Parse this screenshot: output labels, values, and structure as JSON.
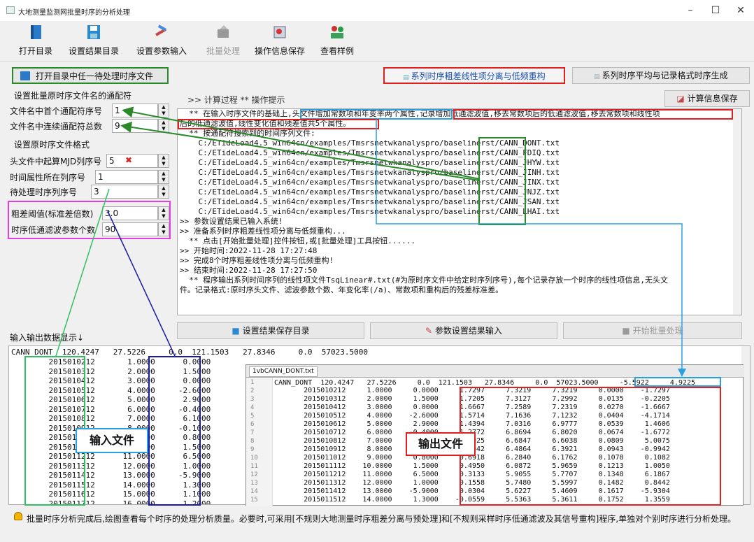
{
  "window": {
    "title": "大地测量监测网批量时序的分析处理",
    "controls": [
      "–",
      "☐",
      "✕"
    ]
  },
  "toolbar": [
    {
      "label": "打开目录",
      "icon": "book-icon",
      "enabled": true
    },
    {
      "label": "设置结果目录",
      "icon": "save-disk-icon",
      "enabled": true
    },
    {
      "label": "设置参数输入",
      "icon": "tools-icon",
      "enabled": true
    },
    {
      "label": "批量处理",
      "icon": "batch-icon",
      "enabled": false
    },
    {
      "label": "操作信息保存",
      "icon": "info-save-icon",
      "enabled": true
    },
    {
      "label": "查看样例",
      "icon": "people-icon",
      "enabled": true
    }
  ],
  "left": {
    "open_button": "打开目录中任一待处理时序文件",
    "group1": "设置批量原时序文件名的通配符",
    "field1_label": "文件名中首个通配符序号",
    "field1_value": "1",
    "field2_label": "文件名中连续通配符总数",
    "field2_value": "9",
    "group2": "设置原时序文件格式",
    "field3_label": "头文件中起算MJD列序号",
    "field3_value": "5",
    "field4_label": "时间属性所在列序号",
    "field4_value": "1",
    "field5_label": "待处理时序列序号",
    "field5_value": "3",
    "field6_label": "粗差阈值(标准差倍数)",
    "field6_value": "3.0",
    "field7_label": "时序低通滤波参数个数",
    "field7_value": "90"
  },
  "tabs": {
    "tab1": "系列时序粗差线性项分离与低频重构",
    "tab2": "系列时序平均与记录格式时序生成"
  },
  "log_header": {
    "prompt": ">> 计算过程  ** 操作提示",
    "save": "计算信息保存"
  },
  "log_lines": [
    "  ** 在输入时序文件的基础上,头文件增加常数项和年变率两个属性,记录增加低通滤波值,移去常数项后的低通滤波值,移去常数项和线性项",
    "后的低通滤波值,线性变化值和残差值共5个属性。",
    "  ** 按通配符搜索到的时间序列文件:",
    "    C:/ETideLoad4.5_win64cn/examples/Tmsrsnetwkanalyspro/baselinerst/CANN_DONT.txt",
    "    C:/ETideLoad4.5_win64cn/examples/Tmsrsnetwkanalyspro/baselinerst/CANN_FDIQ.txt",
    "    C:/ETideLoad4.5_win64cn/examples/Tmsrsnetwkanalyspro/baselinerst/CANN_JHYW.txt",
    "    C:/ETideLoad4.5_win64cn/examples/Tmsrsnetwkanalyspro/baselinerst/CANN_JINH.txt",
    "    C:/ETideLoad4.5_win64cn/examples/Tmsrsnetwkanalyspro/baselinerst/CANN_JINX.txt",
    "    C:/ETideLoad4.5_win64cn/examples/Tmsrsnetwkanalyspro/baselinerst/CANN_JNJZ.txt",
    "    C:/ETideLoad4.5_win64cn/examples/Tmsrsnetwkanalyspro/baselinerst/CANN_JSAN.txt",
    "    C:/ETideLoad4.5_win64cn/examples/Tmsrsnetwkanalyspro/baselinerst/CANN_LHAI.txt",
    ">> 参数设置结果已输入系统!",
    ">> 准备系列时序粗差线性项分离与低频重构...",
    "  ** 点击[开始批量处理]控件按钮,或[批量处理]工具按钮......",
    ">> 开始时间:2022-11-28 17:27:48",
    ">> 完成8个时序粗差线性项分离与低频重构!",
    ">> 结束时间:2022-11-28 17:27:50",
    "  ** 程序输出系列时间序列的线性项文件TsqLinear#.txt(#为原时序文件中给定时序列序号),每个记录存放一个时序的线性项信息,无头文",
    "件。记录格式:原时序头文件、滤波参数个数、年变化率(/a)、常数项和重构后的残差标准差。"
  ],
  "actions": {
    "set_dir": "设置结果保存目录",
    "param_input": "参数设置结果输入",
    "start": "开始批量处理"
  },
  "io_label": "输入输出数据显示↓",
  "input_header": "CANN_DONT  120.4247   27.5226     0.0  121.1503   27.8346     0.0  57023.5000",
  "input_rows": [
    [
      "2015010212",
      "1.0000",
      "0.0000"
    ],
    [
      "2015010312",
      "2.0000",
      "1.5000"
    ],
    [
      "2015010412",
      "3.0000",
      "0.0000"
    ],
    [
      "2015010512",
      "4.0000",
      "-2.6000"
    ],
    [
      "2015010612",
      "5.0000",
      "2.9000"
    ],
    [
      "2015010712",
      "6.0000",
      "-0.4000"
    ],
    [
      "2015010812",
      "7.0000",
      "6.1000"
    ],
    [
      "2015010912",
      "8.0000",
      "-0.1000"
    ],
    [
      "2015011012",
      "9.0000",
      "0.8000"
    ],
    [
      "2015011112",
      "10.0000",
      "1.5000"
    ],
    [
      "2015011212",
      "11.0000",
      "6.5000"
    ],
    [
      "2015011312",
      "12.0000",
      "1.0000"
    ],
    [
      "2015011412",
      "13.0000",
      "-5.9000"
    ],
    [
      "2015011512",
      "14.0000",
      "1.3000"
    ],
    [
      "2015011612",
      "15.0000",
      "1.1000"
    ],
    [
      "2015011712",
      "16.0000",
      "1.2000"
    ]
  ],
  "editor": {
    "tab": "1vbCANN_DONT.txt",
    "header": "CANN_DONT  120.4247   27.5226     0.0  121.1503   27.8346     0.0  57023.5000     -5.5922     4.9225",
    "rows": [
      [
        "2015010212",
        "1.0000",
        "0.0000",
        "1.7297",
        "7.3219",
        "7.3219",
        "0.0000",
        "-1.7297"
      ],
      [
        "2015010312",
        "2.0000",
        "1.5000",
        "1.7205",
        "7.3127",
        "7.2992",
        "0.0135",
        "-0.2205"
      ],
      [
        "2015010412",
        "3.0000",
        "0.0000",
        "1.6667",
        "7.2589",
        "7.2319",
        "0.0270",
        "-1.6667"
      ],
      [
        "2015010512",
        "4.0000",
        "-2.6000",
        "1.5714",
        "7.1636",
        "7.1232",
        "0.0404",
        "-4.1714"
      ],
      [
        "2015010612",
        "5.0000",
        "2.9000",
        "1.4394",
        "7.0316",
        "6.9777",
        "0.0539",
        "1.4606"
      ],
      [
        "2015010712",
        "6.0000",
        "-0.4000",
        "1.2772",
        "6.8694",
        "6.8020",
        "0.0674",
        "-1.6772"
      ],
      [
        "2015010812",
        "7.0000",
        "6.1000",
        "1.0925",
        "6.6847",
        "6.6038",
        "0.0809",
        "5.0075"
      ],
      [
        "2015010912",
        "8.0000",
        "-0.1000",
        "0.8942",
        "6.4864",
        "6.3921",
        "0.0943",
        "-0.9942"
      ],
      [
        "2015011012",
        "9.0000",
        "0.8000",
        "0.6918",
        "6.2840",
        "6.1762",
        "0.1078",
        "0.1082"
      ],
      [
        "2015011112",
        "10.0000",
        "1.5000",
        "0.4950",
        "6.0872",
        "5.9659",
        "0.1213",
        "1.0050"
      ],
      [
        "2015011212",
        "11.0000",
        "6.5000",
        "0.3133",
        "5.9055",
        "5.7707",
        "0.1348",
        "6.1867"
      ],
      [
        "2015011312",
        "12.0000",
        "1.0000",
        "0.1558",
        "5.7480",
        "5.5997",
        "0.1482",
        "0.8442"
      ],
      [
        "2015011412",
        "13.0000",
        "-5.9000",
        "0.0304",
        "5.6227",
        "5.4609",
        "0.1617",
        "-5.9304"
      ],
      [
        "2015011512",
        "14.0000",
        "1.3000",
        "-0.0559",
        "5.5363",
        "5.3611",
        "0.1752",
        "1.3559"
      ]
    ]
  },
  "annotations": {
    "input": "输入文件",
    "output": "输出文件"
  },
  "status": "批量时序分析完成后,绘图查看每个时序的处理分析质量。必要时,可采用[不规则大地测量时序粗差分离与预处理]和[不规则采样时序低通滤波及其信号重构]程序,单独对个别时序进行分析处理。",
  "colors": {
    "red": "#e02020",
    "green": "#2a8a2a",
    "blue": "#1a1aa8",
    "lightblue": "#2aa0e0",
    "magenta": "#e040e0",
    "lime": "#30c060"
  }
}
